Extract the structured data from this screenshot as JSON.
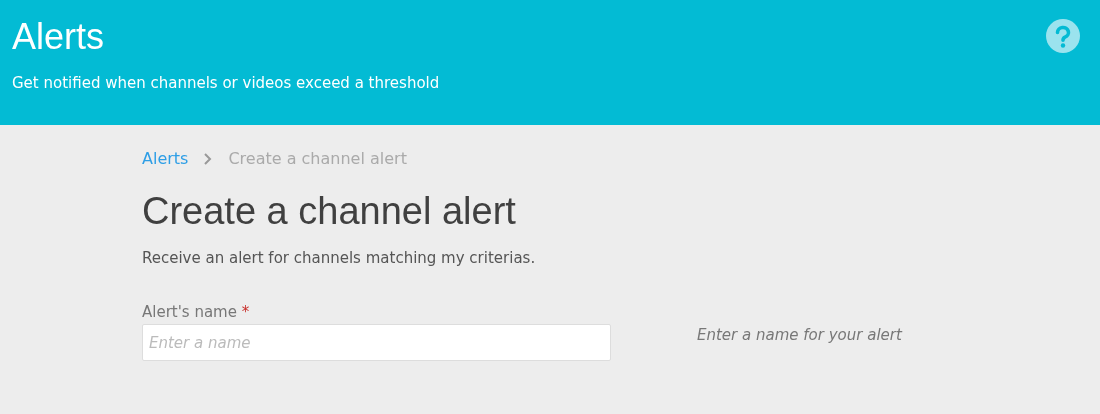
{
  "header": {
    "title": "Alerts",
    "subtitle": "Get notified when channels or videos exceed a threshold"
  },
  "breadcrumb": [
    {
      "label": "Alerts",
      "kind": "link"
    },
    {
      "label": "Create a channel alert",
      "kind": "current"
    }
  ],
  "page": {
    "title": "Create a channel alert",
    "description": "Receive an alert for channels matching my criterias."
  },
  "form": {
    "fields": [
      {
        "label": "Alert's name",
        "required_mark": "*",
        "placeholder": "Enter a name",
        "hint": "Enter a name for your alert"
      }
    ]
  }
}
